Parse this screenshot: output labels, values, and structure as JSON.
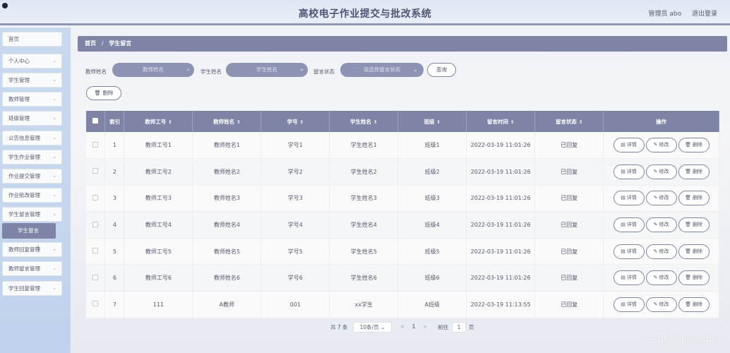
{
  "header": {
    "title": "高校电子作业提交与批改系统",
    "user": "管理员 abo",
    "logout": "退出登录"
  },
  "sidebar": {
    "items": [
      {
        "label": "首页",
        "chevron": false
      },
      {
        "label": "个人中心",
        "chevron": true
      },
      {
        "label": "学生管理",
        "chevron": true
      },
      {
        "label": "教师管理",
        "chevron": true
      },
      {
        "label": "班级管理",
        "chevron": true
      },
      {
        "label": "公告信息管理",
        "chevron": true
      },
      {
        "label": "学生作业管理",
        "chevron": true
      },
      {
        "label": "作业提交管理",
        "chevron": true
      },
      {
        "label": "作业批改管理",
        "chevron": true
      },
      {
        "label": "学生留言管理",
        "chevron": true
      },
      {
        "label": "教师回复管理",
        "chevron": true
      },
      {
        "label": "教师留言管理",
        "chevron": true
      },
      {
        "label": "学生回复管理",
        "chevron": true
      }
    ],
    "active_sub": "学生留言"
  },
  "breadcrumb": {
    "home": "首页",
    "separator": "/",
    "current": "学生留言"
  },
  "search": {
    "teacher_label": "教师姓名",
    "teacher_placeholder": "教师姓名",
    "student_label": "学生姓名",
    "student_placeholder": "学生姓名",
    "status_label": "留言状态",
    "status_placeholder": "请选择留言状态",
    "query_button": "查询"
  },
  "toolbar": {
    "delete_button": "删除"
  },
  "table": {
    "columns": [
      "索引",
      "教师工号",
      "教师姓名",
      "学号",
      "学生姓名",
      "班级",
      "留言时间",
      "留言状态",
      "操作"
    ],
    "rows": [
      {
        "index": "1",
        "teacher_no": "教师工号1",
        "teacher_name": "教师姓名1",
        "student_no": "学号1",
        "student_name": "学生姓名1",
        "class": "班级1",
        "time": "2022-03-19 11:01:26",
        "status": "已回复"
      },
      {
        "index": "2",
        "teacher_no": "教师工号2",
        "teacher_name": "教师姓名2",
        "student_no": "学号2",
        "student_name": "学生姓名2",
        "class": "班级2",
        "time": "2022-03-19 11:01:26",
        "status": "已回复"
      },
      {
        "index": "3",
        "teacher_no": "教师工号3",
        "teacher_name": "教师姓名3",
        "student_no": "学号3",
        "student_name": "学生姓名3",
        "class": "班级3",
        "time": "2022-03-19 11:01:26",
        "status": "已回复"
      },
      {
        "index": "4",
        "teacher_no": "教师工号4",
        "teacher_name": "教师姓名4",
        "student_no": "学号4",
        "student_name": "学生姓名4",
        "class": "班级4",
        "time": "2022-03-19 11:01:26",
        "status": "已回复"
      },
      {
        "index": "5",
        "teacher_no": "教师工号5",
        "teacher_name": "教师姓名5",
        "student_no": "学号5",
        "student_name": "学生姓名5",
        "class": "班级5",
        "time": "2022-03-19 11:01:26",
        "status": "已回复"
      },
      {
        "index": "6",
        "teacher_no": "教师工号6",
        "teacher_name": "教师姓名6",
        "student_no": "学号6",
        "student_name": "学生姓名6",
        "class": "班级6",
        "time": "2022-03-19 11:01:26",
        "status": "已回复"
      },
      {
        "index": "7",
        "teacher_no": "111",
        "teacher_name": "A教师",
        "student_no": "001",
        "student_name": "xx学生",
        "class": "A班级",
        "time": "2022-03-19 11:13:55",
        "status": "已回复"
      }
    ],
    "actions": {
      "detail": "详情",
      "edit": "修改",
      "delete": "删除"
    }
  },
  "pagination": {
    "total": "共 7 条",
    "page_size": "10条/页",
    "prev": "<",
    "current_page": "1",
    "next": ">",
    "goto_label": "前往",
    "goto_value": "1",
    "page_unit": "页"
  },
  "watermark": "CSDN @bishe409",
  "icons": {
    "search": "search-icon",
    "select": "chevron-down-icon",
    "detail": "doc-icon",
    "edit": "pencil-icon",
    "delete": "trash-icon",
    "sort": "sort-icon"
  },
  "colors": {
    "accent": "#7d84a6",
    "header_title": "#4e5575",
    "sidebar_bg": "#c5d6ee"
  }
}
